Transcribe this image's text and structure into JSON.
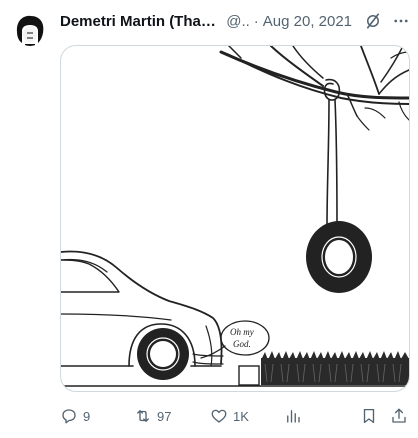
{
  "tweet": {
    "author_name": "Demetri Martin (That...",
    "handle": "@..",
    "separator": "·",
    "date": "Aug 20, 2021",
    "image_caption": "Oh my God.",
    "caption_line1": "Oh my",
    "caption_line2": "God."
  },
  "actions": {
    "replies": "9",
    "retweets": "97",
    "likes": "1K"
  },
  "colors": {
    "text_primary": "#0f1419",
    "text_secondary": "#536471",
    "border": "#cfd9de"
  },
  "icons": {
    "reply": "speech-bubble-icon",
    "retweet": "retweet-icon",
    "like": "heart-icon",
    "views": "bar-chart-icon",
    "bookmark": "bookmark-icon",
    "share": "share-icon",
    "grok": "grok-icon",
    "more": "more-icon"
  }
}
